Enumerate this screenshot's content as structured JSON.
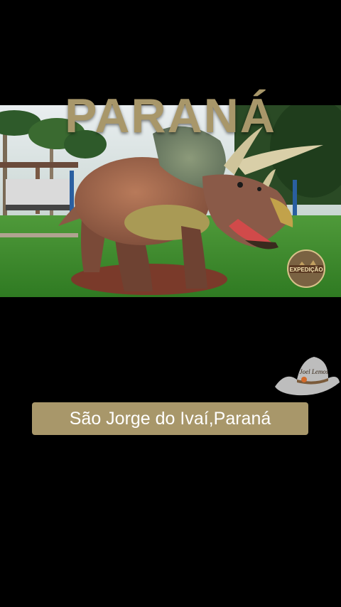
{
  "video_title": "PARANÁ",
  "location_caption": "São Jorge do Ivaí,Paraná",
  "expedition_badge": {
    "label": "EXPEDIÇÃO",
    "icon": "expedition-logo-icon"
  },
  "hat_logo": {
    "label": "Joel Lemos",
    "icon": "cowboy-hat-icon"
  },
  "colors": {
    "accent_gold": "#a8976a",
    "background": "#000000",
    "caption_text": "#ffffff"
  }
}
